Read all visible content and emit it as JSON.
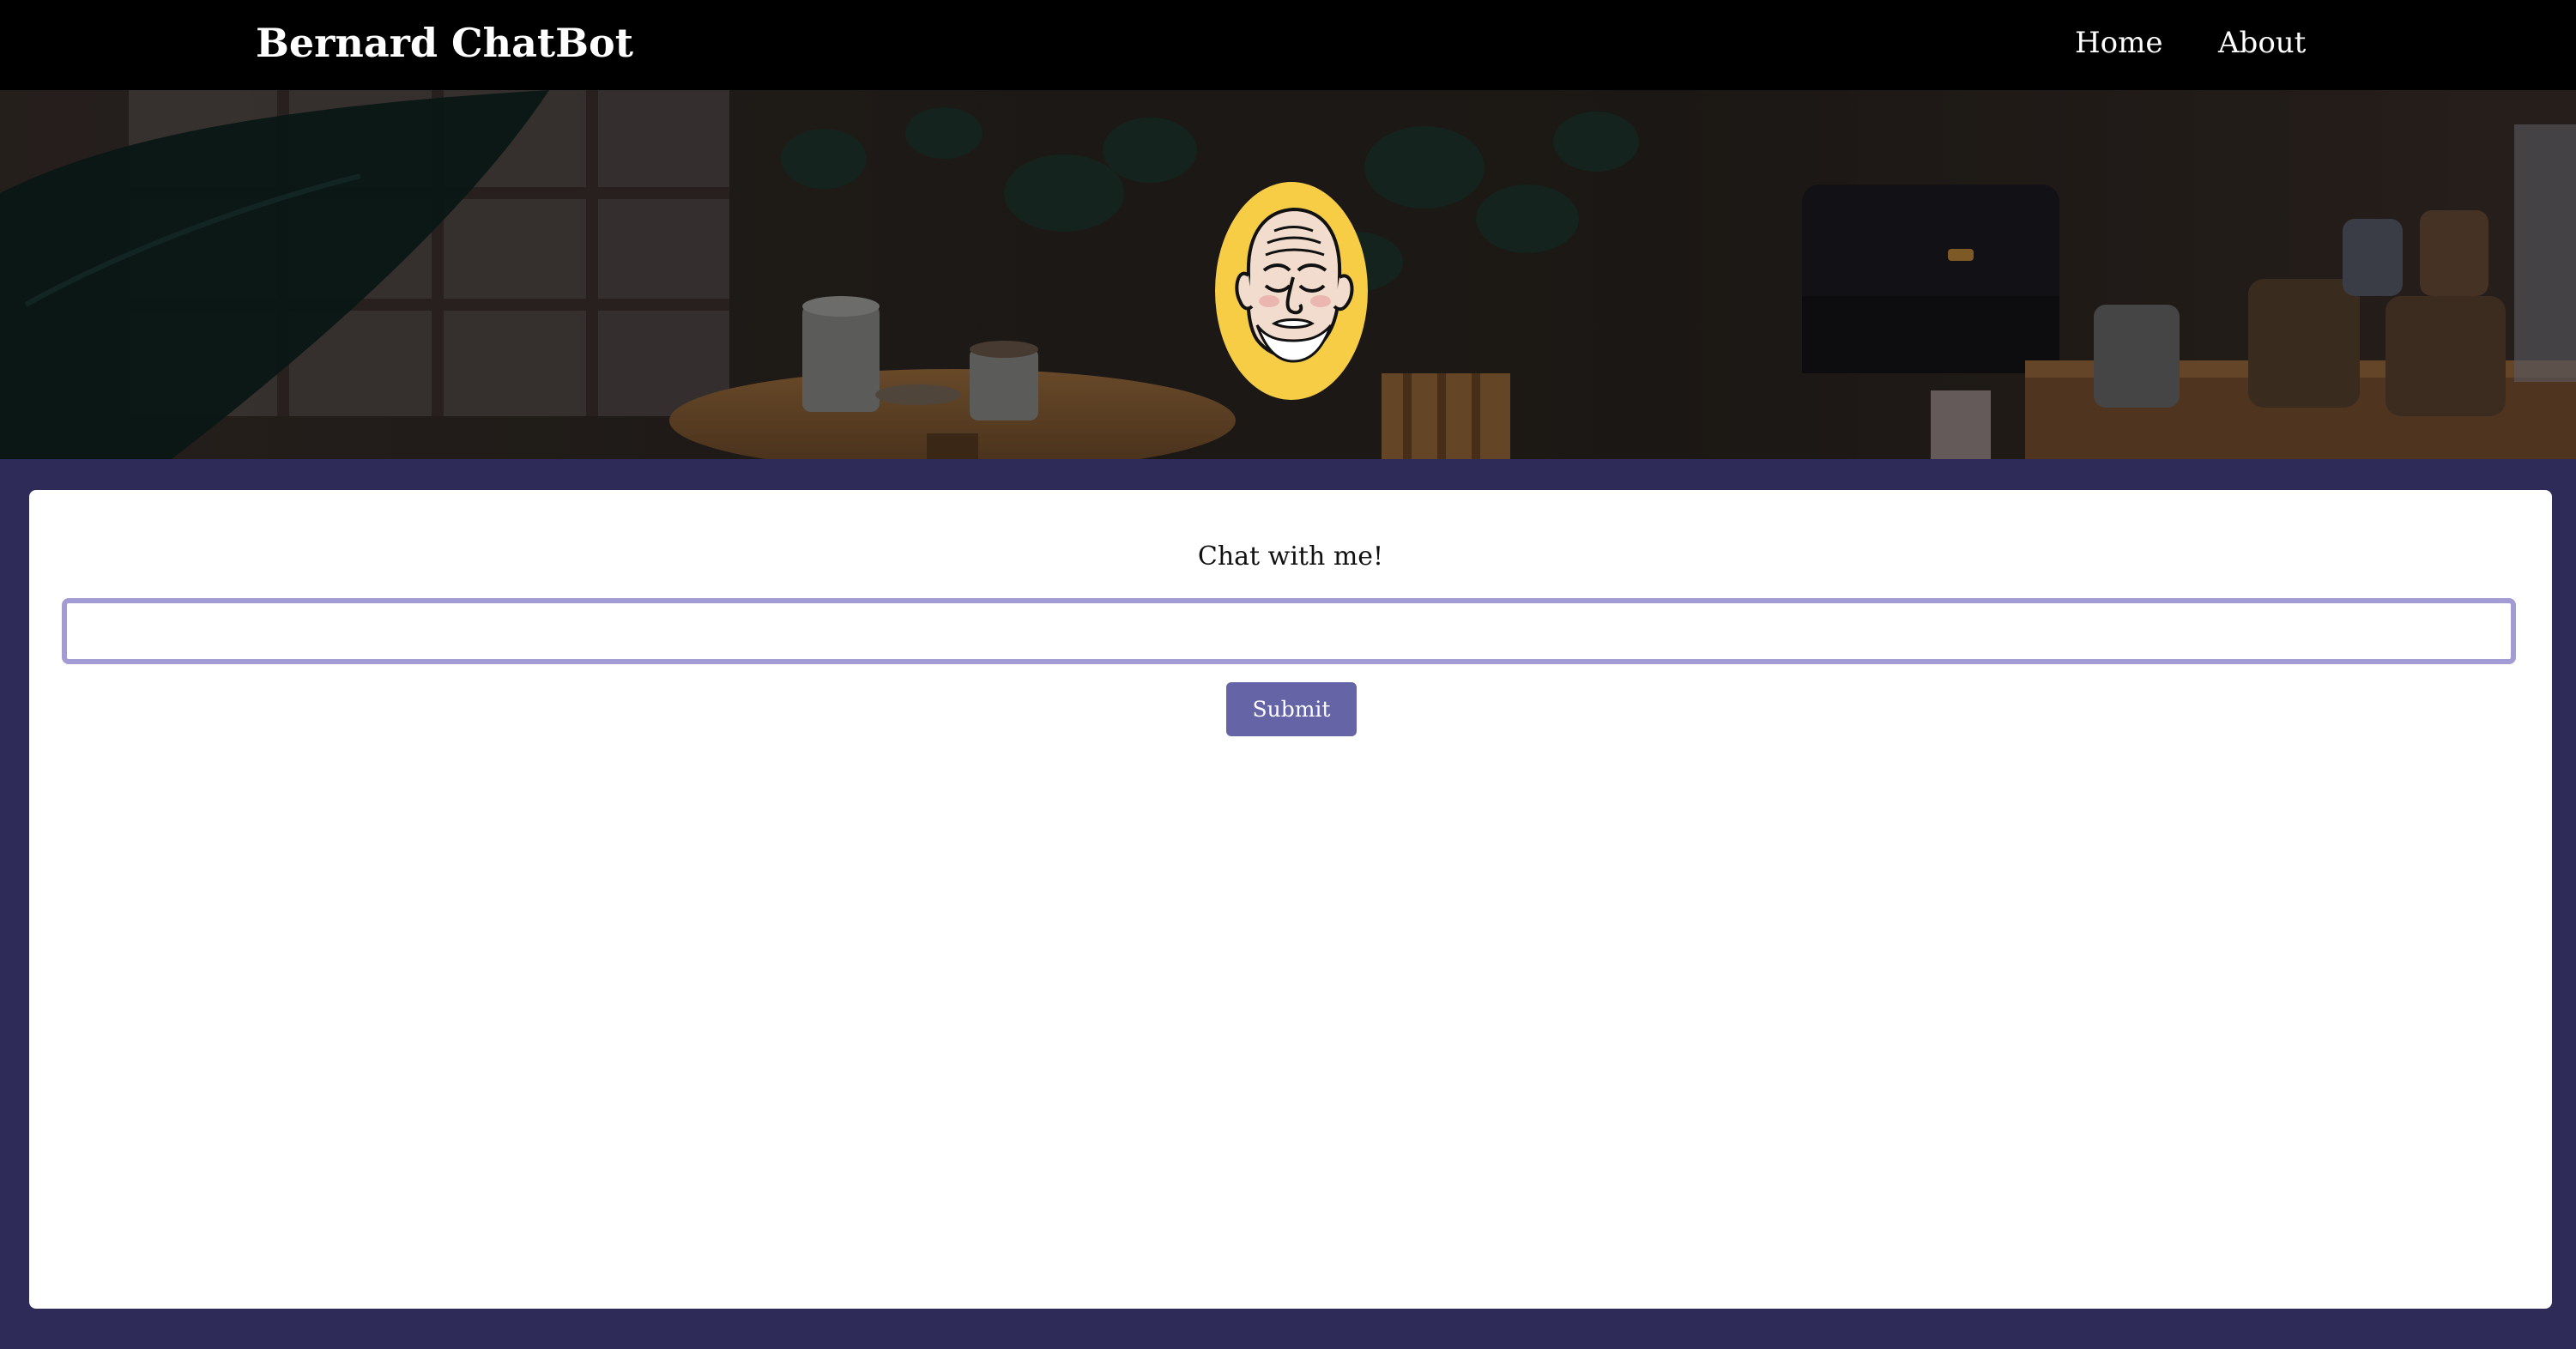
{
  "navbar": {
    "brand": "Bernard ChatBot",
    "links": [
      {
        "label": "Home"
      },
      {
        "label": "About"
      }
    ]
  },
  "hero": {
    "avatar_icon": "old-man-cartoon-avatar",
    "background": "cozy-cafe-illustration"
  },
  "chat": {
    "label": "Chat with me!",
    "input_value": "",
    "input_placeholder": "",
    "submit_label": "Submit"
  },
  "colors": {
    "navbar_bg": "#000000",
    "page_bg": "#2e2b58",
    "card_bg": "#ffffff",
    "input_border": "#a39bd4",
    "button_bg": "#6464a6",
    "avatar_bg": "#f7cd45"
  }
}
